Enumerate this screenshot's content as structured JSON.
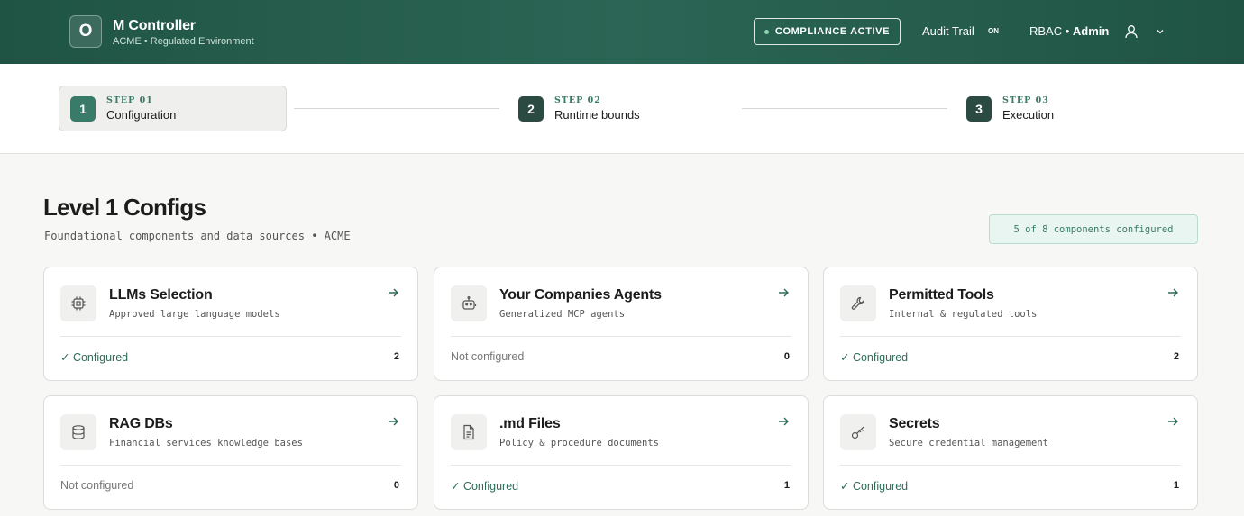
{
  "header": {
    "logo_letter": "O",
    "app_title": "M Controller",
    "app_subtitle": "ACME • Regulated Environment",
    "compliance_label": "COMPLIANCE ACTIVE",
    "audit_label": "Audit Trail",
    "audit_state": "ON",
    "rbac_prefix": "RBAC • ",
    "rbac_role": "Admin"
  },
  "steps": [
    {
      "label": "STEP 01",
      "name": "Configuration",
      "num": "1",
      "active": true
    },
    {
      "label": "STEP 02",
      "name": "Runtime bounds",
      "num": "2",
      "active": false
    },
    {
      "label": "STEP 03",
      "name": "Execution",
      "num": "3",
      "active": false
    }
  ],
  "section": {
    "title": "Level 1 Configs",
    "subtitle": "Foundational components and data sources • ACME",
    "progress": "5 of 8 components configured"
  },
  "cards": [
    {
      "title": "LLMs Selection",
      "desc": "Approved large language models",
      "status": "✓ Configured",
      "configured": true,
      "count": "2",
      "icon": "chip-icon"
    },
    {
      "title": "Your Companies Agents",
      "desc": "Generalized MCP agents",
      "status": "Not configured",
      "configured": false,
      "count": "0",
      "icon": "robot-icon"
    },
    {
      "title": "Permitted Tools",
      "desc": "Internal & regulated tools",
      "status": "✓ Configured",
      "configured": true,
      "count": "2",
      "icon": "wrench-icon"
    },
    {
      "title": "RAG DBs",
      "desc": "Financial services knowledge bases",
      "status": "Not configured",
      "configured": false,
      "count": "0",
      "icon": "database-icon"
    },
    {
      "title": ".md Files",
      "desc": "Policy & procedure documents",
      "status": "✓ Configured",
      "configured": true,
      "count": "1",
      "icon": "document-icon"
    },
    {
      "title": "Secrets",
      "desc": "Secure credential management",
      "status": "✓ Configured",
      "configured": true,
      "count": "1",
      "icon": "key-icon"
    }
  ],
  "colors": {
    "brand": "#2c6555",
    "accent": "#3a7a68",
    "configured": "#2e6b59"
  }
}
